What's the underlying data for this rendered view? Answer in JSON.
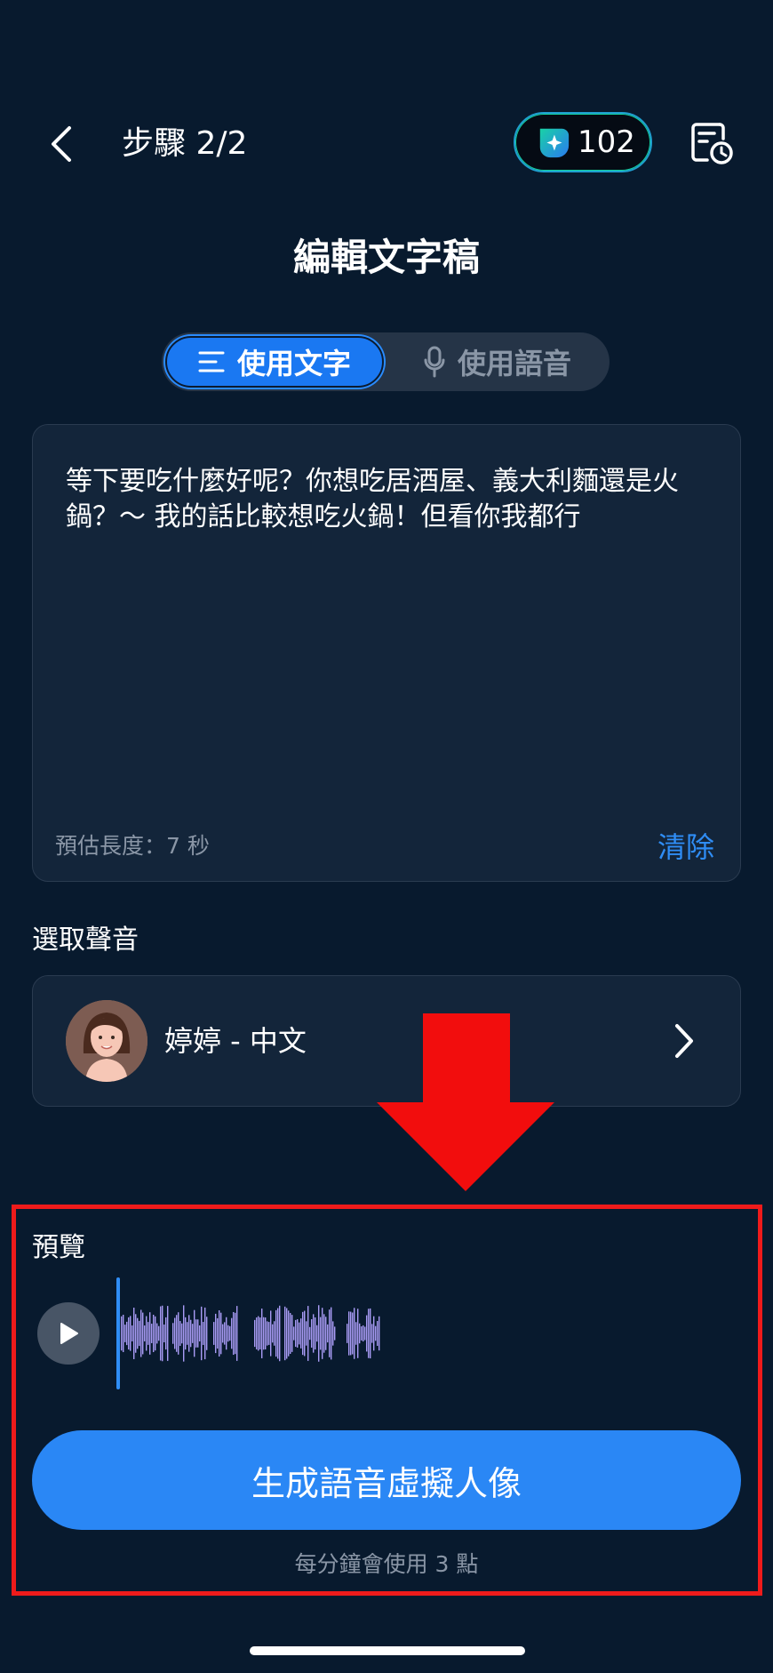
{
  "header": {
    "step_label": "步驟 2/2",
    "credits": "102"
  },
  "page_title": "編輯文字稿",
  "mode_tabs": [
    {
      "label": "使用文字",
      "active": true
    },
    {
      "label": "使用語音",
      "active": false
    }
  ],
  "script": {
    "text": "等下要吃什麼好呢？你想吃居酒屋、義大利麵還是火鍋？～ 我的話比較想吃火鍋！但看你我都行",
    "duration_label": "預估長度：7 秒",
    "clear_label": "清除"
  },
  "voice": {
    "section_label": "選取聲音",
    "selected": "婷婷 - 中文"
  },
  "preview": {
    "section_label": "預覽"
  },
  "generate": {
    "button_label": "生成語音虛擬人像",
    "cost_note": "每分鐘會使用 3 點"
  },
  "colors": {
    "background": "#081a2e",
    "accent": "#2a87f5",
    "card": "#13253a",
    "waveform": "#a99bf5",
    "annotation": "#ef1b1b"
  },
  "icons": {
    "back": "chevron-left-icon",
    "credits": "sparkle-shield-icon",
    "history": "document-clock-icon",
    "text_tab": "lines-icon",
    "voice_tab": "microphone-icon",
    "voice_next": "chevron-right-icon",
    "play": "play-icon"
  }
}
